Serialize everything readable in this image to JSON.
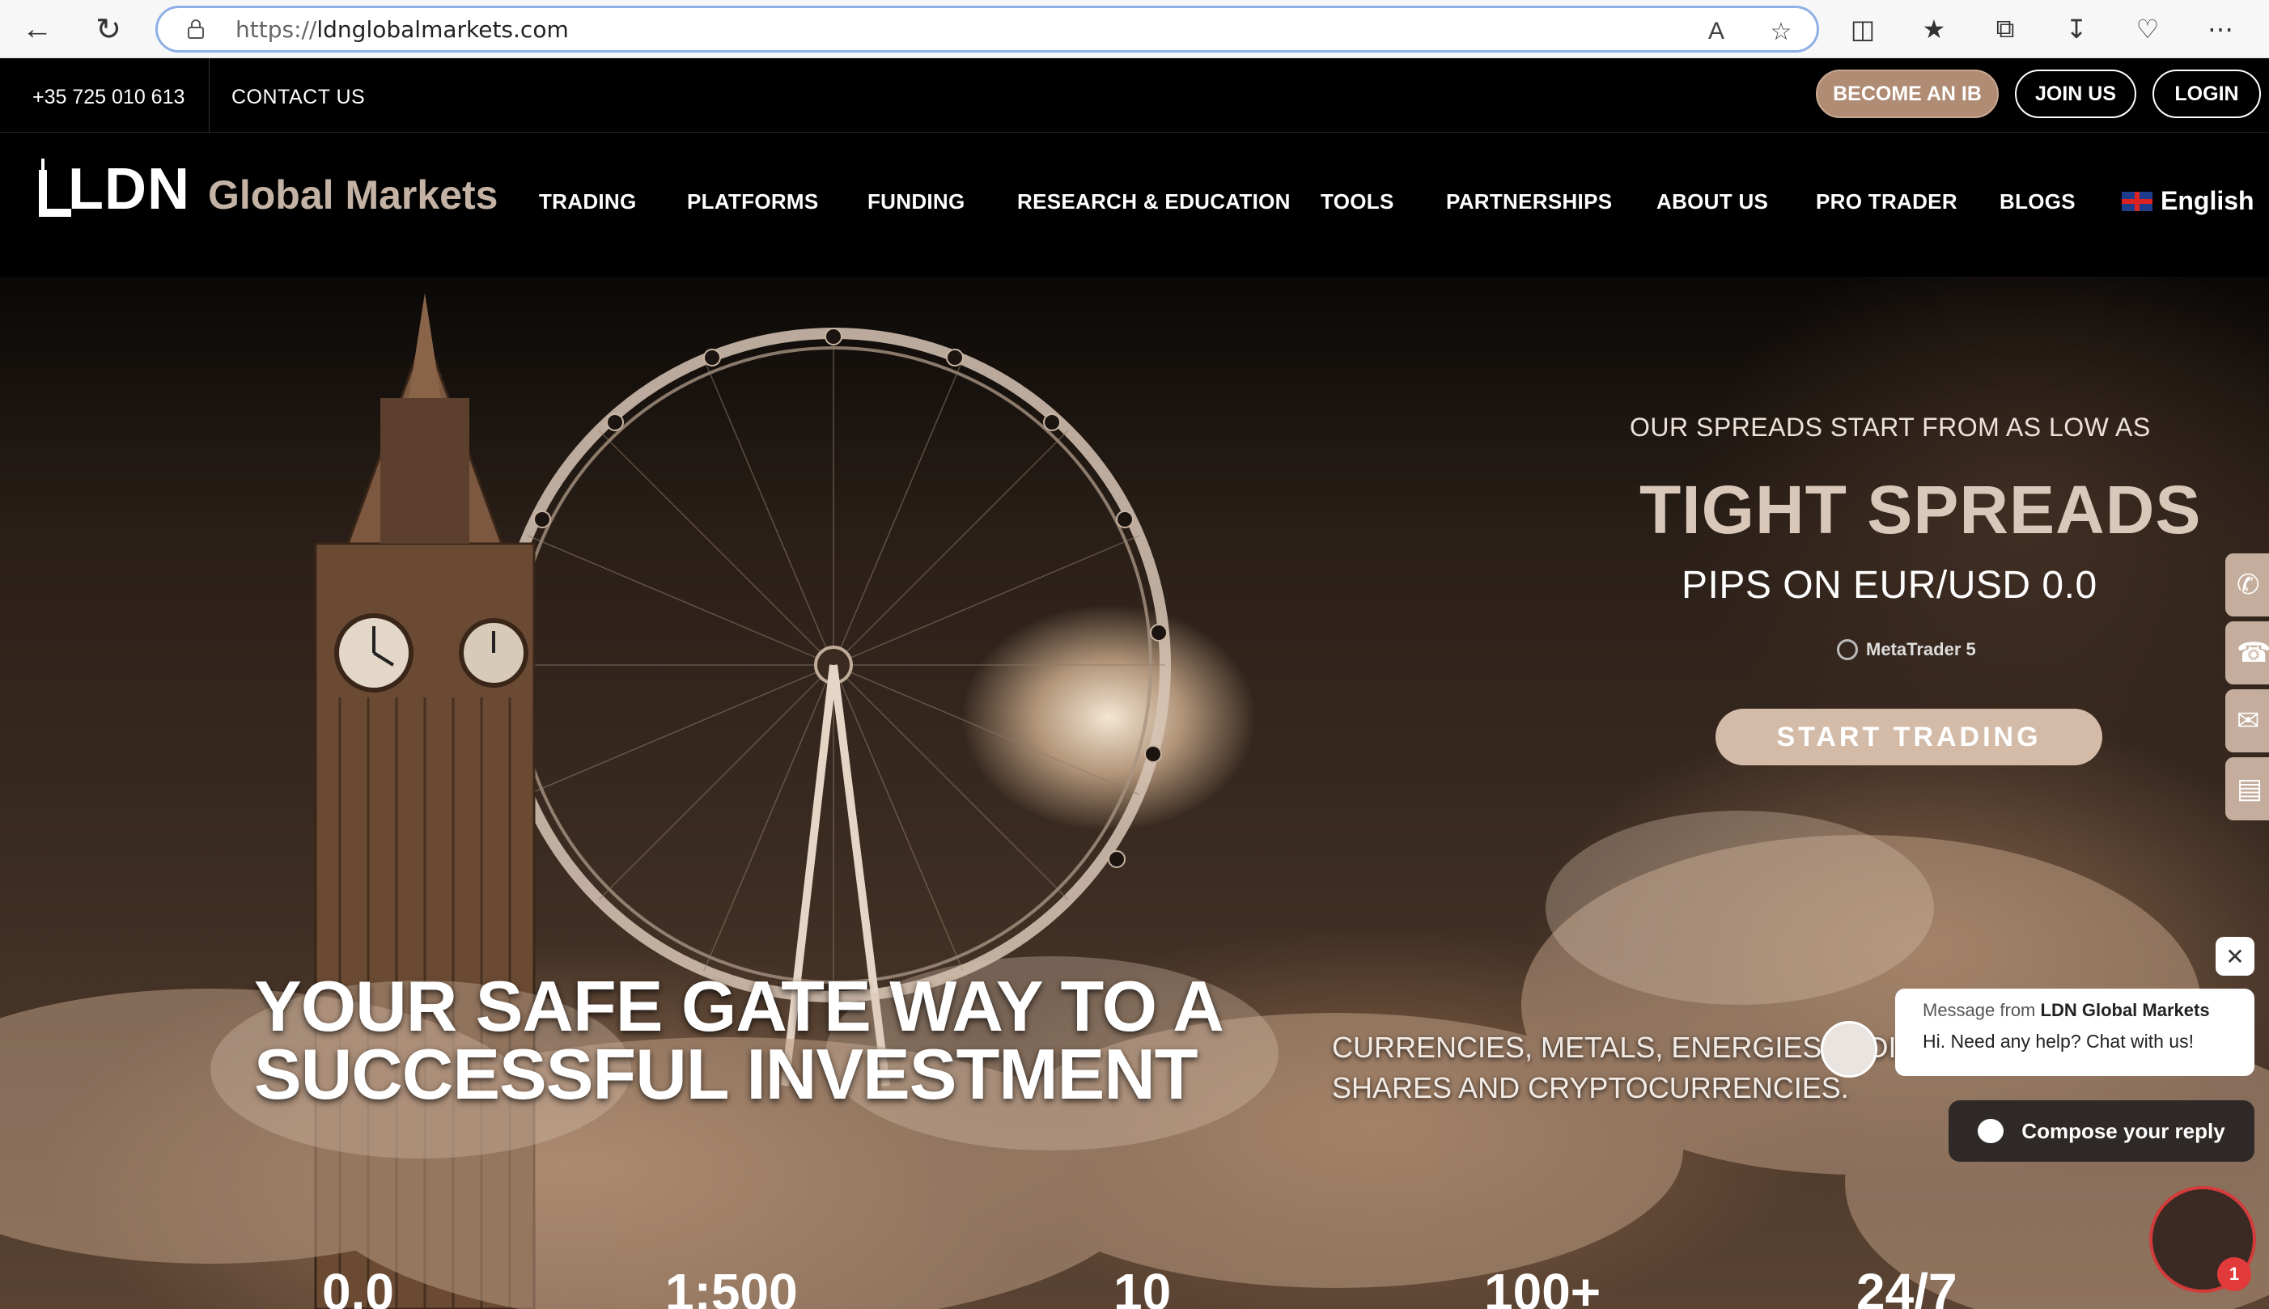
{
  "browser": {
    "url_proto": "https://",
    "url_host": "ldnglobalmarkets.com"
  },
  "topbar": {
    "phone": "+35 725 010 613",
    "contact": "CONTACT US",
    "become_ib": "BECOME AN IB",
    "join": "JOIN US",
    "login": "LOGIN"
  },
  "logo": {
    "ldn": "LDN",
    "global_markets": "Global Markets"
  },
  "nav": {
    "items": [
      "TRADING",
      "PLATFORMS",
      "FUNDING",
      "RESEARCH & EDUCATION",
      "TOOLS",
      "PARTNERSHIPS",
      "ABOUT US",
      "PRO TRADER",
      "BLOGS"
    ],
    "language": "English"
  },
  "hero": {
    "spreads_intro": "OUR SPREADS START FROM AS LOW AS",
    "tight_spreads": "TIGHT SPREADS",
    "pips": "PIPS ON EUR/USD 0.0",
    "platform": "MetaTrader 5",
    "cta": "START TRADING",
    "headline_1": "YOUR SAFE GATE WAY TO A",
    "headline_2": "SUCCESSFUL INVESTMENT",
    "sub_1": "CURRENCIES, METALS, ENERGIES, INDICES,",
    "sub_2": "SHARES AND CRYPTOCURRENCIES."
  },
  "stats": [
    "0.0",
    "1:500",
    "10",
    "100+",
    "24/7"
  ],
  "chat": {
    "from_prefix": "Message from",
    "from_name": "LDN Global Markets",
    "message": "Hi. Need any help? Chat with us!",
    "compose": "Compose your reply",
    "badge": "1"
  },
  "icons": {
    "side": [
      "whatsapp-icon",
      "phone-icon",
      "mail-icon",
      "chat-icon"
    ]
  },
  "colors": {
    "accent": "#b08c74",
    "cta": "#d3bba8"
  }
}
